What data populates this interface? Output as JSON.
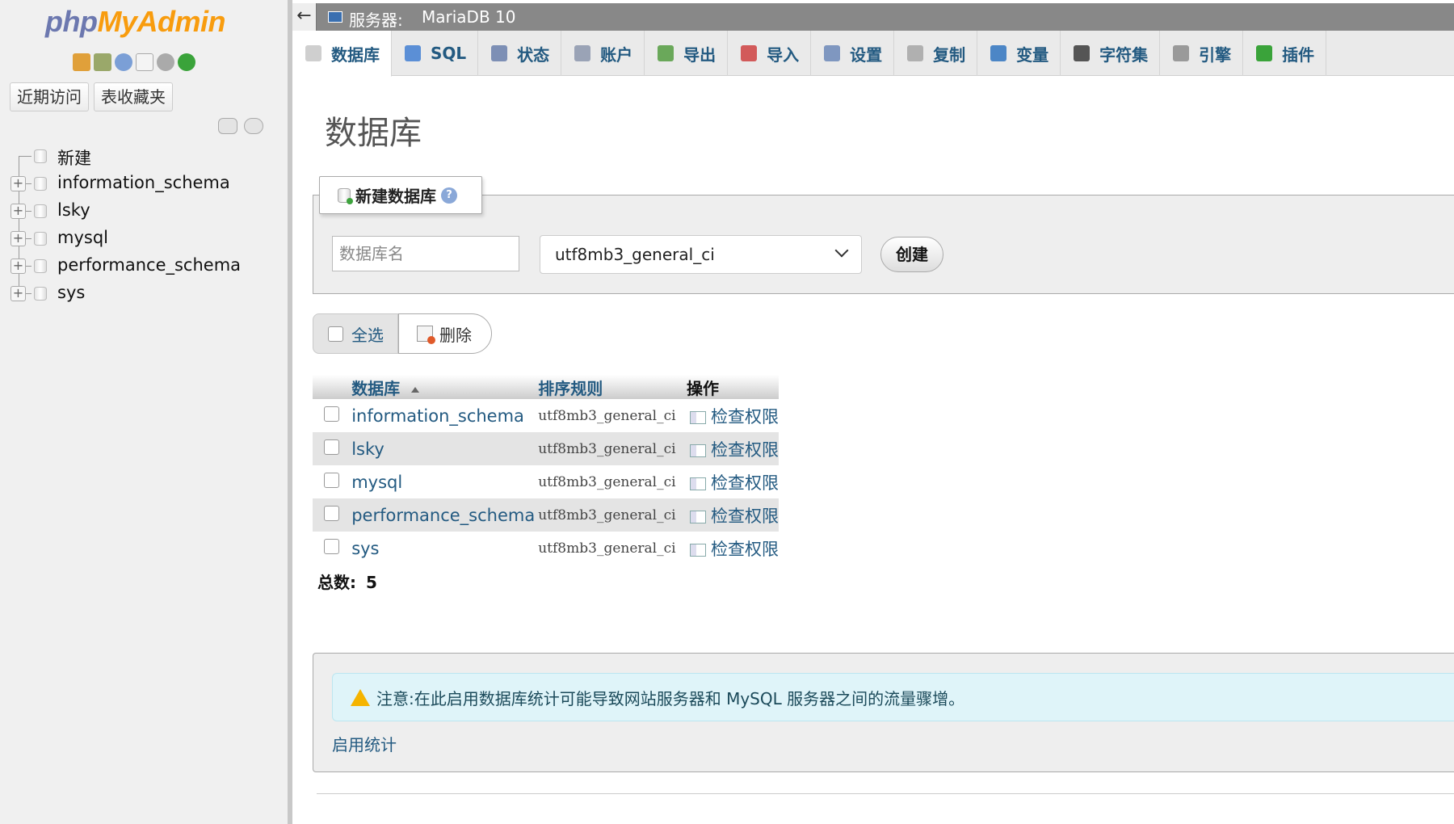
{
  "nav": {
    "logo": {
      "part1": "php",
      "part2": "MyAdmin"
    },
    "icons": [
      "home-icon",
      "logout-icon",
      "help-icon",
      "docs-icon",
      "settings-icon",
      "reload-icon"
    ],
    "tabs": [
      "近期访问",
      "表收藏夹"
    ],
    "tree": [
      {
        "label": "新建",
        "kind": "new"
      },
      {
        "label": "information_schema",
        "kind": "db"
      },
      {
        "label": "lsky",
        "kind": "db"
      },
      {
        "label": "mysql",
        "kind": "db"
      },
      {
        "label": "performance_schema",
        "kind": "db"
      },
      {
        "label": "sys",
        "kind": "db"
      }
    ]
  },
  "serverbar": {
    "label": "服务器:",
    "name": "MariaDB 10",
    "collapse": "←"
  },
  "tabs": [
    {
      "label": "数据库",
      "icon": "database-icon",
      "color": "#cfcfcf",
      "active": true
    },
    {
      "label": "SQL",
      "icon": "sql-icon",
      "color": "#5b8fd6"
    },
    {
      "label": "状态",
      "icon": "status-icon",
      "color": "#7d8fb5"
    },
    {
      "label": "账户",
      "icon": "accounts-icon",
      "color": "#9aa3b6"
    },
    {
      "label": "导出",
      "icon": "export-icon",
      "color": "#6aa85a"
    },
    {
      "label": "导入",
      "icon": "import-icon",
      "color": "#d25a5a"
    },
    {
      "label": "设置",
      "icon": "wrench-icon",
      "color": "#7f97c0"
    },
    {
      "label": "复制",
      "icon": "replication-icon",
      "color": "#b0b0b0"
    },
    {
      "label": "变量",
      "icon": "variables-icon",
      "color": "#4c86c6"
    },
    {
      "label": "字符集",
      "icon": "charset-icon",
      "color": "#555555"
    },
    {
      "label": "引擎",
      "icon": "engine-icon",
      "color": "#9a9a9a"
    },
    {
      "label": "插件",
      "icon": "plugin-icon",
      "color": "#3aa33a"
    }
  ],
  "page_title": "数据库",
  "create": {
    "legend": "新建数据库",
    "name_placeholder": "数据库名",
    "collation": "utf8mb3_general_ci",
    "button": "创建"
  },
  "bulk": {
    "select_all": "全选",
    "delete": "删除"
  },
  "table": {
    "headers": {
      "database": "数据库",
      "collation": "排序规则",
      "action": "操作"
    },
    "rows": [
      {
        "name": "information_schema",
        "collation": "utf8mb3_general_ci",
        "action": "检查权限"
      },
      {
        "name": "lsky",
        "collation": "utf8mb3_general_ci",
        "action": "检查权限"
      },
      {
        "name": "mysql",
        "collation": "utf8mb3_general_ci",
        "action": "检查权限"
      },
      {
        "name": "performance_schema",
        "collation": "utf8mb3_general_ci",
        "action": "检查权限"
      },
      {
        "name": "sys",
        "collation": "utf8mb3_general_ci",
        "action": "检查权限"
      }
    ]
  },
  "total": {
    "label": "总数:",
    "value": "5"
  },
  "notice": {
    "text": "注意:在此启用数据库统计可能导致网站服务器和 MySQL 服务器之间的流量骤增。",
    "enable_link": "启用统计"
  }
}
